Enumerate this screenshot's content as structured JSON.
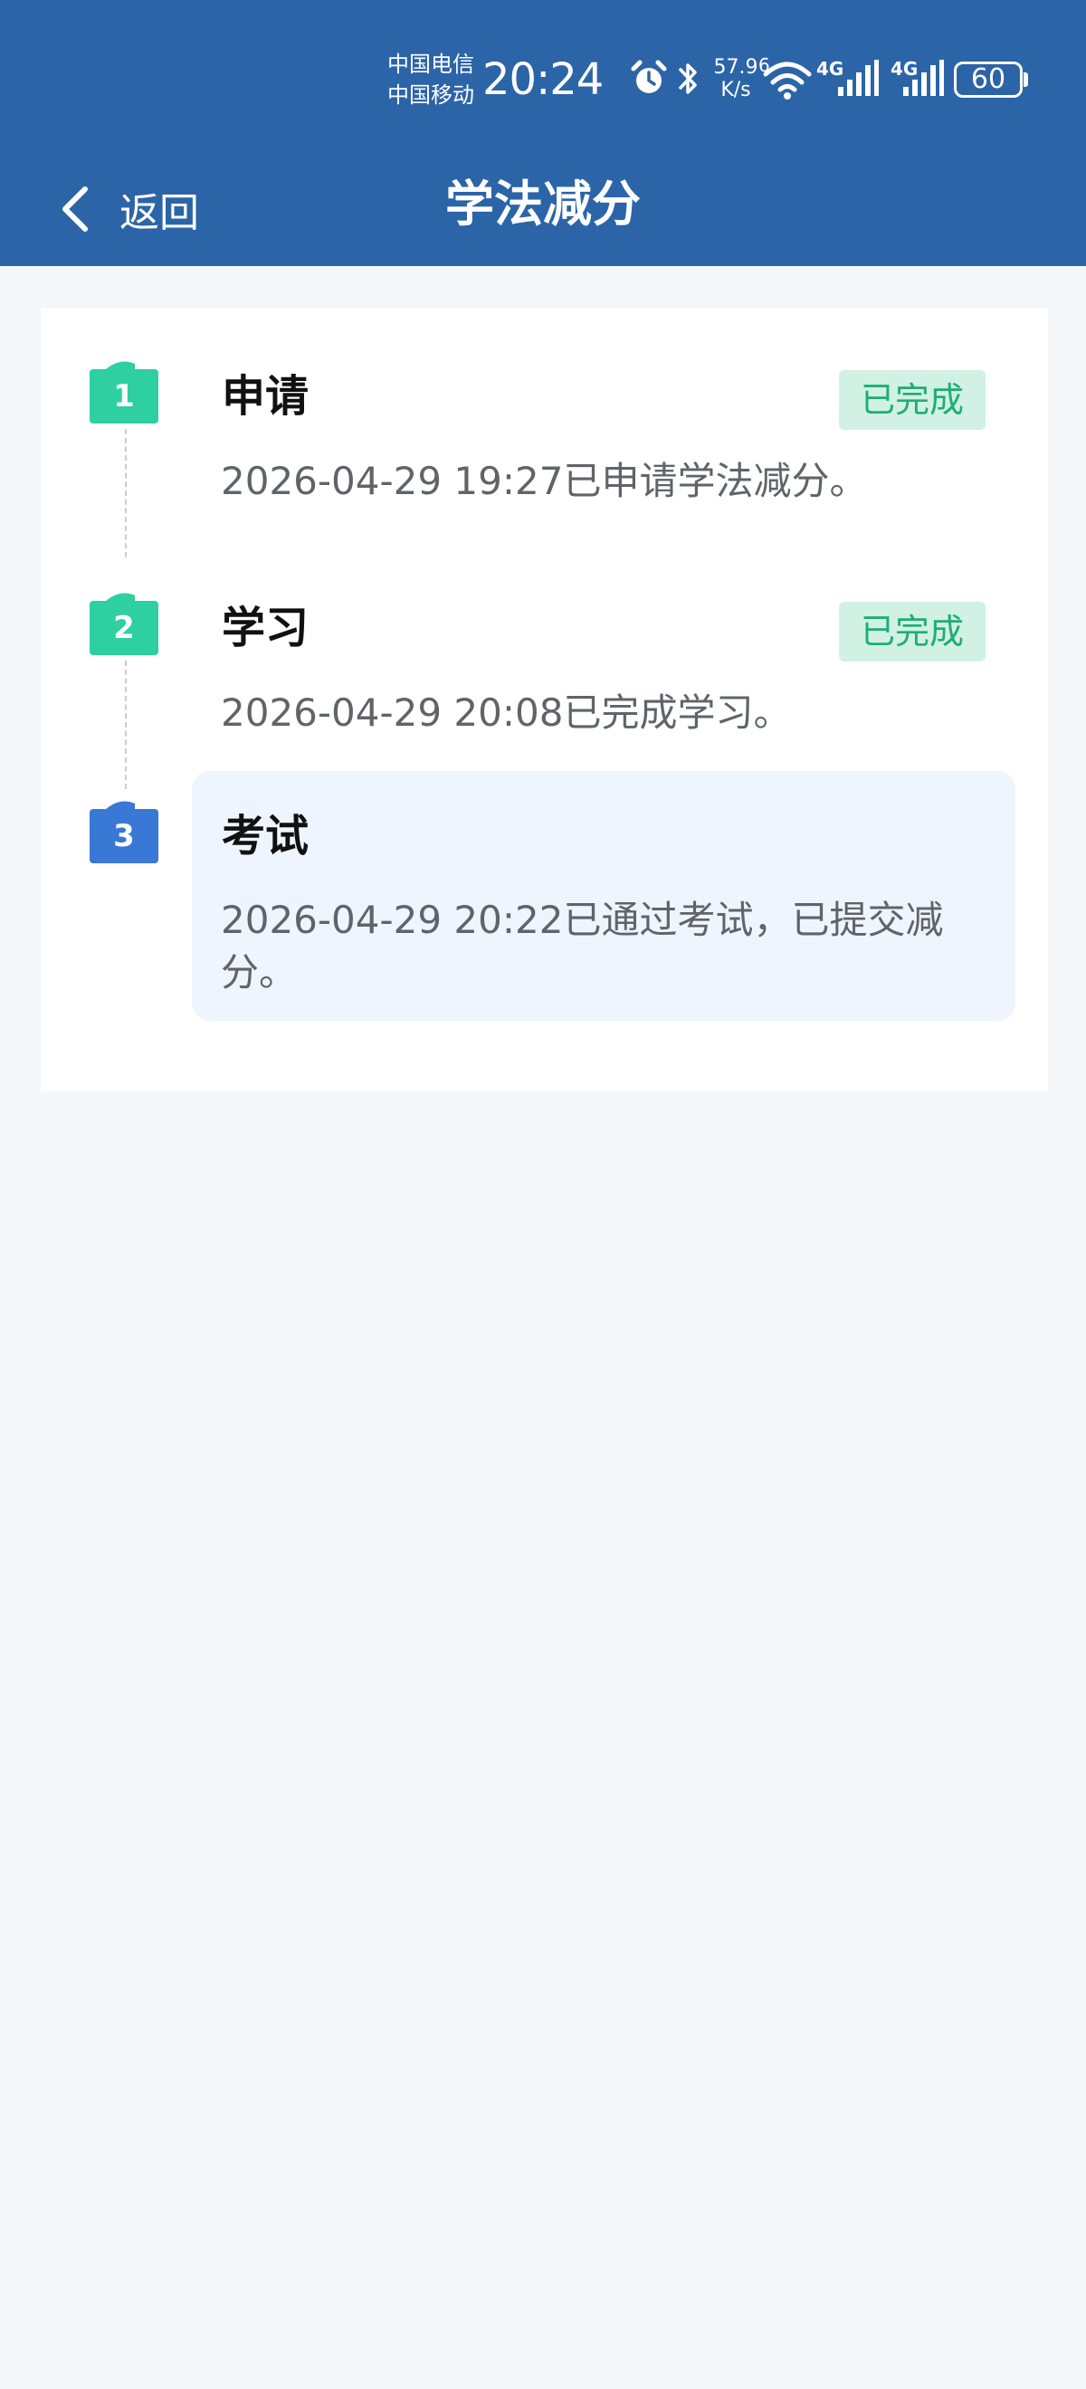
{
  "status_bar": {
    "carrier_1": "中国电信",
    "carrier_2": "中国移动",
    "time": "20:24",
    "net_speed_value": "57.9",
    "net_speed_unit": "K/s",
    "wifi_label": "6",
    "signal_1_label": "4G",
    "signal_2_label": "4G",
    "battery": "60",
    "icons": [
      "alarm-icon",
      "bluetooth-icon",
      "wifi-icon",
      "signal-icon",
      "signal-icon",
      "battery-icon"
    ]
  },
  "nav": {
    "back_label": "返回",
    "title": "学法减分"
  },
  "steps": [
    {
      "number": "1",
      "title": "申请",
      "status": "已完成",
      "description": "2026-04-29 19:27已申请学法减分。",
      "badge_color": "#2ecfa1"
    },
    {
      "number": "2",
      "title": "学习",
      "status": "已完成",
      "description": "2026-04-29 20:08已完成学习。",
      "badge_color": "#2ecfa1"
    },
    {
      "number": "3",
      "title": "考试",
      "status": "",
      "description": "2026-04-29 20:22已通过考试，已提交减分。",
      "badge_color": "#3a78d6"
    }
  ],
  "colors": {
    "header_bg": "#2c64a8",
    "page_bg": "#f3f7f9",
    "done_badge_bg": "#d0f1e4",
    "done_badge_text": "#20ad74",
    "active_step_bg": "#eef5fe"
  }
}
